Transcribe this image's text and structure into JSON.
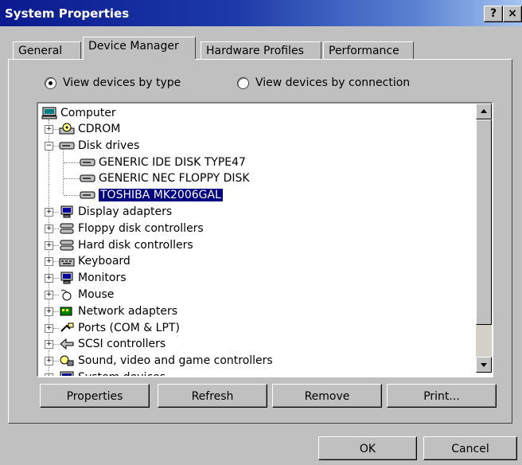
{
  "window": {
    "title": "System Properties",
    "help_glyph": "?",
    "close_glyph": "×"
  },
  "tabs": [
    {
      "label": "General"
    },
    {
      "label": "Device Manager"
    },
    {
      "label": "Hardware Profiles"
    },
    {
      "label": "Performance"
    }
  ],
  "view_options": {
    "by_type": {
      "label": "View devices by type",
      "selected": true
    },
    "by_connection": {
      "label": "View devices by connection",
      "selected": false
    }
  },
  "tree": {
    "root": "Computer",
    "items": [
      {
        "label": "CDROM",
        "icon": "cdrom-icon",
        "expander": "+"
      },
      {
        "label": "Disk drives",
        "icon": "disk-drive-icon",
        "expander": "−"
      },
      {
        "label": "GENERIC IDE  DISK TYPE47",
        "icon": "disk-drive-icon",
        "child": true
      },
      {
        "label": "GENERIC NEC  FLOPPY DISK",
        "icon": "disk-drive-icon",
        "child": true
      },
      {
        "label": "TOSHIBA MK2006GAL",
        "icon": "disk-drive-icon",
        "child": true,
        "selected": true
      },
      {
        "label": "Display adapters",
        "icon": "monitor-icon",
        "expander": "+"
      },
      {
        "label": "Floppy disk controllers",
        "icon": "controller-icon",
        "expander": "+"
      },
      {
        "label": "Hard disk controllers",
        "icon": "controller-icon",
        "expander": "+"
      },
      {
        "label": "Keyboard",
        "icon": "keyboard-icon",
        "expander": "+"
      },
      {
        "label": "Monitors",
        "icon": "monitor-icon",
        "expander": "+"
      },
      {
        "label": "Mouse",
        "icon": "mouse-icon",
        "expander": "+"
      },
      {
        "label": "Network adapters",
        "icon": "network-icon",
        "expander": "+"
      },
      {
        "label": "Ports (COM & LPT)",
        "icon": "port-icon",
        "expander": "+"
      },
      {
        "label": "SCSI controllers",
        "icon": "scsi-icon",
        "expander": "+"
      },
      {
        "label": "Sound, video and game controllers",
        "icon": "sound-icon",
        "expander": "+"
      },
      {
        "label": "System devices",
        "icon": "computer-icon",
        "expander": "+"
      }
    ]
  },
  "buttons": {
    "properties": "Properties",
    "refresh": "Refresh",
    "remove": "Remove",
    "print": "Print...",
    "ok": "OK",
    "cancel": "Cancel"
  }
}
